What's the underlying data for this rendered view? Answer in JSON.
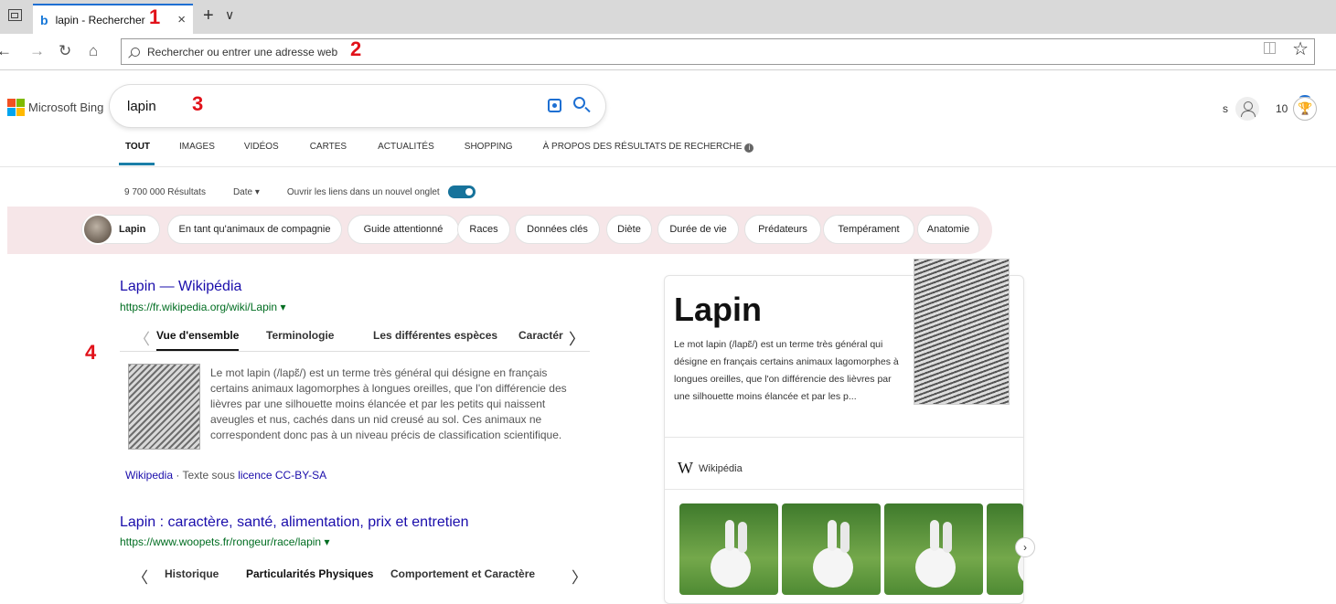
{
  "browser": {
    "tab_title": "lapin - Rechercher",
    "tab_favicon": "b",
    "new_tab_glyph": "+",
    "tab_menu_glyph": "∨",
    "close_glyph": "×",
    "address_placeholder": "Rechercher ou entrer une adresse web",
    "nav": {
      "back": "←",
      "forward": "→",
      "refresh": "↻",
      "home": "⌂"
    },
    "favorites_glyph": "☆"
  },
  "annotations": {
    "m1": "1",
    "m2": "2",
    "m3": "3",
    "m4": "4"
  },
  "bing": {
    "logo_text": "Microsoft Bing",
    "query": "lapin",
    "account_initial": "s",
    "rewards_points": "10",
    "scopes": [
      "TOUT",
      "IMAGES",
      "VIDÉOS",
      "CARTES",
      "ACTUALITÉS",
      "SHOPPING",
      "À PROPOS DES RÉSULTATS DE RECHERCHE"
    ],
    "result_count": "9 700 000 Résultats",
    "date_filter": "Date",
    "new_tab_toggle_label": "Ouvrir les liens dans un nouvel onglet",
    "pills": [
      "Lapin",
      "En tant qu'animaux de compagnie",
      "Guide attentionné",
      "Races",
      "Données clés",
      "Diète",
      "Durée de vie",
      "Prédateurs",
      "Tempérament",
      "Anatomie"
    ]
  },
  "results": [
    {
      "title": "Lapin — Wikipédia",
      "url": "https://fr.wikipedia.org/wiki/Lapin",
      "tabs": [
        "Vue d'ensemble",
        "Terminologie",
        "Les différentes espèces",
        "Caractér"
      ],
      "snippet": "Le mot lapin (/lapɛ̃/) est un terme très général qui désigne en français certains animaux lagomorphes à longues oreilles, que l'on différencie des lièvres par une silhouette moins élancée et par les petits qui naissent aveugles et nus, cachés dans un nid creusé au sol. Ces animaux ne correspondent donc pas à un niveau précis de classification scientifique.",
      "source_name": "Wikipedia",
      "license_text": " · Texte sous ",
      "license_link": "licence CC-BY-SA"
    },
    {
      "title": "Lapin : caractère, santé, alimentation, prix et entretien",
      "url": "https://www.woopets.fr/rongeur/race/lapin",
      "tabs": [
        "Historique",
        "Particularités Physiques",
        "Comportement et Caractère"
      ]
    }
  ],
  "knowledge_panel": {
    "title": "Lapin",
    "description": "Le mot lapin (/lapɛ̃/) est un terme très général qui désigne en français certains animaux lagomorphes à longues oreilles, que l'on différencie des lièvres par une silhouette moins élancée et par les p...",
    "source_glyph": "W",
    "source": "Wikipédia"
  }
}
